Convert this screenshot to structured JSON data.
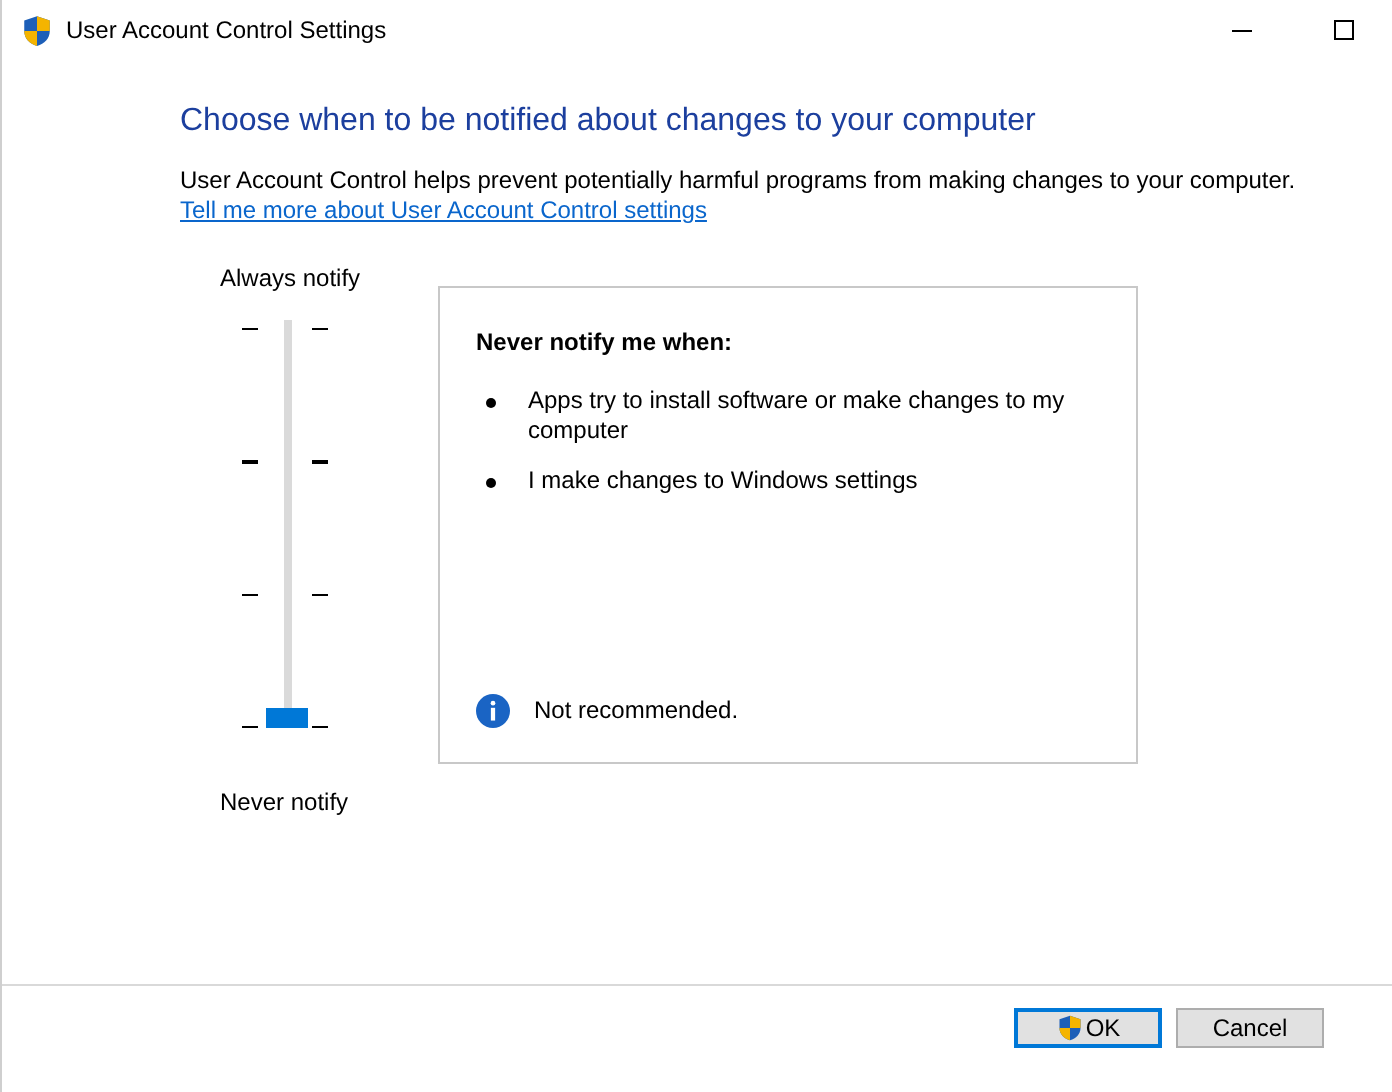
{
  "window": {
    "title": "User Account Control Settings"
  },
  "heading": "Choose when to be notified about changes to your computer",
  "description": "User Account Control helps prevent potentially harmful programs from making changes to your computer.",
  "link": "Tell me more about User Account Control settings",
  "slider": {
    "top_label": "Always notify",
    "bottom_label": "Never notify",
    "level": 0
  },
  "info_box": {
    "title": "Never notify me when:",
    "items": [
      "Apps try to install software or make changes to my computer",
      "I make changes to Windows settings"
    ],
    "note": "Not recommended."
  },
  "buttons": [
    {
      "label": "OK",
      "kind": "shield",
      "default": true
    },
    {
      "label": "Cancel",
      "kind": "plain",
      "default": false
    }
  ]
}
